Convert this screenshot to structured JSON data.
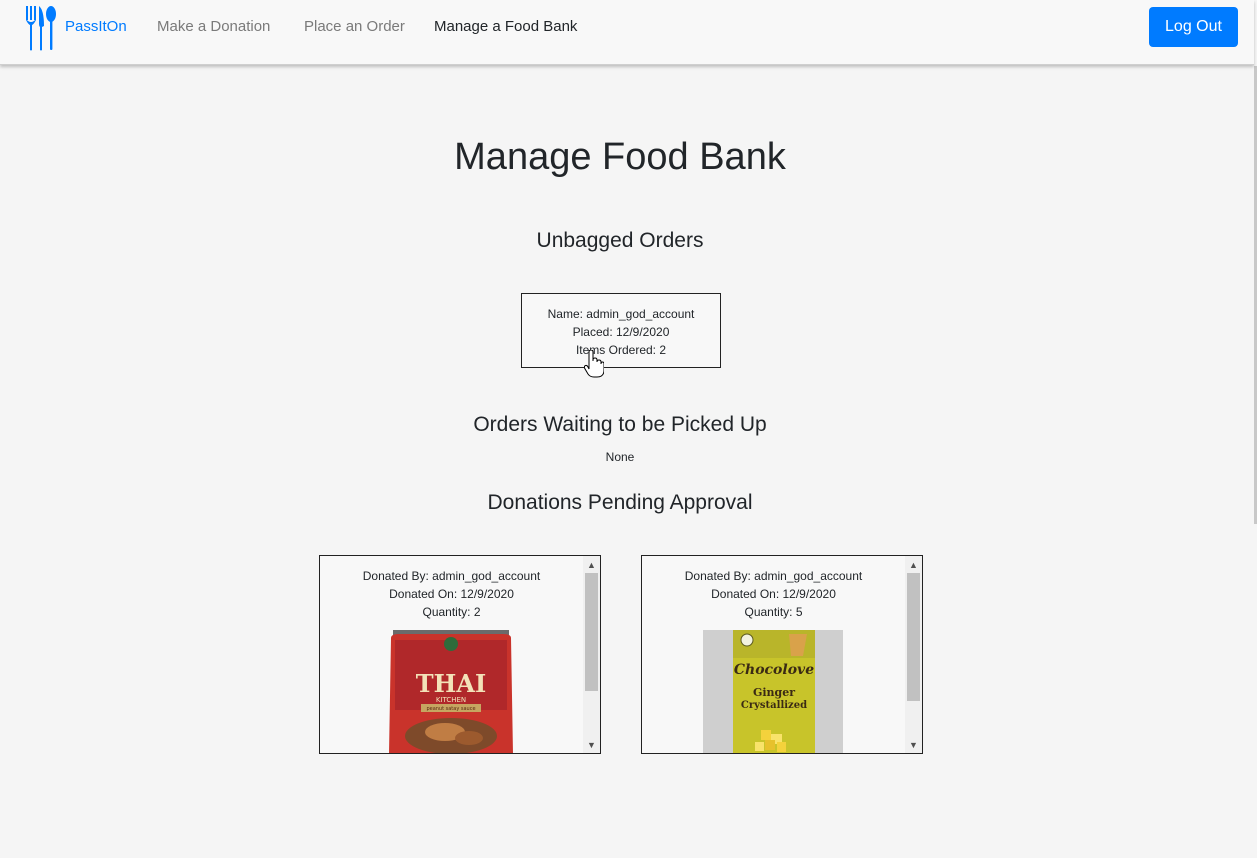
{
  "nav": {
    "brand": "PassItOn",
    "links": [
      {
        "label": "Make a Donation"
      },
      {
        "label": "Place an Order"
      },
      {
        "label": "Manage a Food Bank"
      }
    ],
    "logout_label": "Log Out",
    "accent_color": "#007bff"
  },
  "main": {
    "title": "Manage Food Bank",
    "unbagged": {
      "heading": "Unbagged Orders",
      "orders": [
        {
          "name": "Name: admin_god_account",
          "placed": "Placed: 12/9/2020",
          "items": "Items Ordered: 2"
        }
      ]
    },
    "waiting": {
      "heading": "Orders Waiting to be Picked Up",
      "empty_text": "None"
    },
    "donations": {
      "heading": "Donations Pending Approval",
      "items": [
        {
          "donated_by": "Donated By: admin_god_account",
          "donated_on": "Donated On: 12/9/2020",
          "quantity": "Quantity: 2",
          "image_label": "THAI",
          "image_sublabel": "KITCHEN",
          "image_detail": "peanut satay sauce"
        },
        {
          "donated_by": "Donated By: admin_god_account",
          "donated_on": "Donated On: 12/9/2020",
          "quantity": "Quantity: 5",
          "image_label": "Chocolove",
          "image_sublabel": "Ginger",
          "image_detail": "Crystallized"
        }
      ]
    }
  }
}
